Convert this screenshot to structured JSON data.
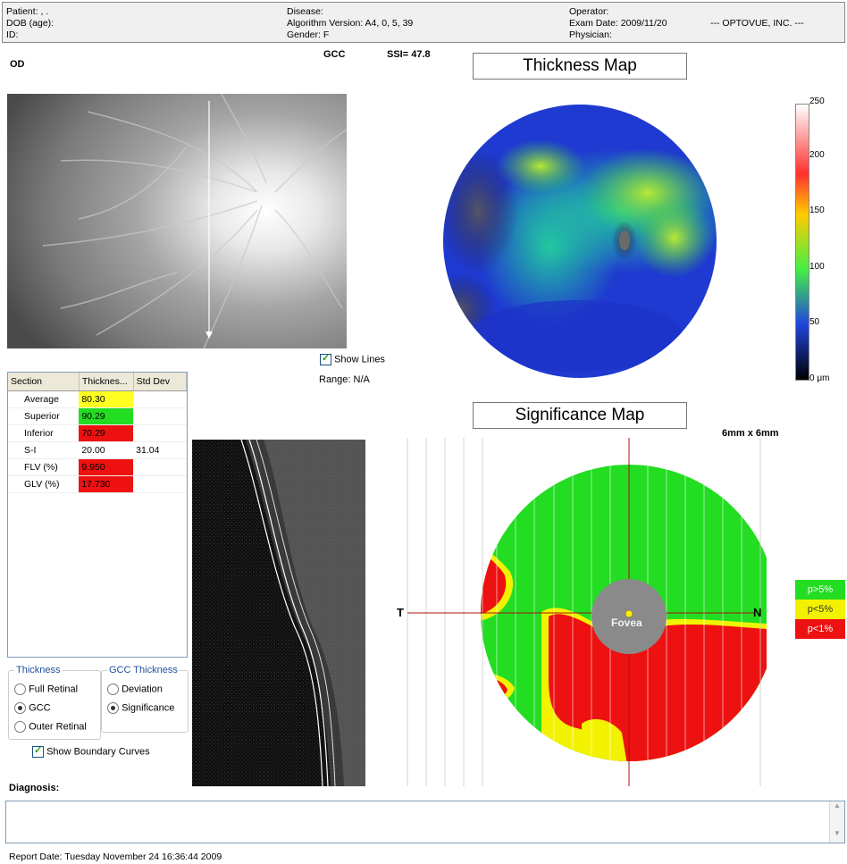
{
  "header": {
    "patient_label": "Patient: , .",
    "dob_label": "DOB (age):",
    "id_label": "ID:",
    "disease_label": "Disease:",
    "algorithm_label": "Algorithm Version: A4, 0, 5, 39",
    "gender_label": "Gender: F",
    "operator_label": "Operator:",
    "exam_date_label": "Exam Date: 2009/11/20",
    "physician_label": "Physician:",
    "company": "--- OPTOVUE, INC. ---"
  },
  "eye": "OD",
  "scan_type": "GCC",
  "ssi": "SSI= 47.8",
  "thickness_map": {
    "title": "Thickness Map",
    "scale_ticks": [
      "250",
      "200",
      "150",
      "100",
      "50",
      "0 μm"
    ]
  },
  "show_lines_label": "Show Lines",
  "range_label": "Range: N/A",
  "significance_map": {
    "title": "Significance Map",
    "size_label": "6mm x 6mm",
    "t_label": "T",
    "n_label": "N",
    "fovea_label": "Fovea",
    "legend": [
      {
        "label": "p>5%",
        "color": "#22dd22"
      },
      {
        "label": "p<5%",
        "color": "#f2f200"
      },
      {
        "label": "p<1%",
        "color": "#ee1111"
      }
    ]
  },
  "section_table": {
    "headers": [
      "Section",
      "Thicknes...",
      "Std Dev"
    ],
    "rows": [
      {
        "section": "Average",
        "thickness": "80.30",
        "std": "",
        "color": "#ffff22"
      },
      {
        "section": "Superior",
        "thickness": "90.29",
        "std": "",
        "color": "#22dd22"
      },
      {
        "section": "Inferior",
        "thickness": "70.29",
        "std": "",
        "color": "#ee1111"
      },
      {
        "section": "S-I",
        "thickness": "20.00",
        "std": "31.04",
        "color": ""
      },
      {
        "section": "FLV (%)",
        "thickness": "9.950",
        "std": "",
        "color": "#ee1111"
      },
      {
        "section": "GLV (%)",
        "thickness": "17.730",
        "std": "",
        "color": "#ee1111"
      }
    ]
  },
  "thickness_group": {
    "legend": "Thickness",
    "options": [
      "Full Retinal",
      "GCC",
      "Outer Retinal"
    ],
    "selected": "GCC"
  },
  "gcc_group": {
    "legend": "GCC Thickness",
    "options": [
      "Deviation",
      "Significance"
    ],
    "selected": "Significance"
  },
  "show_boundary_label": "Show Boundary Curves",
  "diagnosis_label": "Diagnosis:",
  "report_date": "Report Date: Tuesday November 24 16:36:44 2009"
}
